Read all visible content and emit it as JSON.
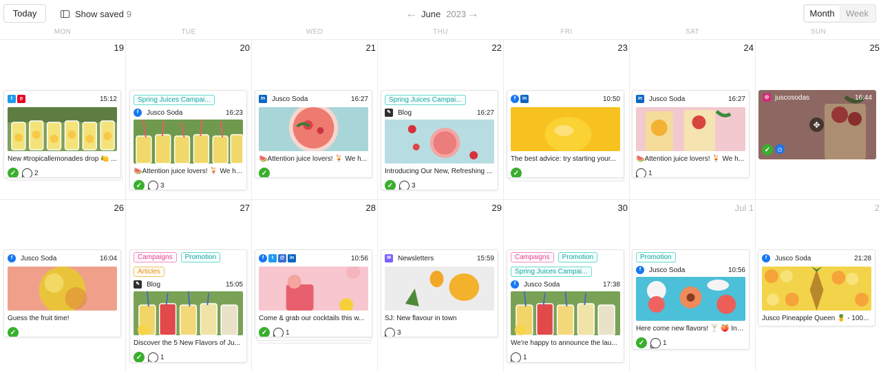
{
  "toolbar": {
    "today_label": "Today",
    "show_saved_label": "Show saved",
    "show_saved_count": "9",
    "month_label": "June",
    "year_label": "2023",
    "view_month": "Month",
    "view_week": "Week"
  },
  "day_names": [
    "MON",
    "TUE",
    "WED",
    "THU",
    "FRI",
    "SAT",
    "SUN"
  ],
  "weeks": [
    {
      "days": [
        "19",
        "20",
        "21",
        "22",
        "23",
        "24",
        "25"
      ]
    },
    {
      "days": [
        "26",
        "27",
        "28",
        "29",
        "30",
        "Jul 1",
        "2"
      ]
    }
  ],
  "posts": {
    "mon19": {
      "time": "15:12",
      "caption": "New #tropicallemonades drop 🍋 ...",
      "comments": "2",
      "networks": [
        "twitter-icon",
        "pinterest-icon"
      ]
    },
    "tue20": {
      "tag1": "Spring Juices Campai...",
      "account": "Jusco Soda",
      "time": "16:23",
      "caption": "🍉Attention juice lovers! 🍹 We ha...",
      "comments": "3"
    },
    "wed21": {
      "account": "Jusco Soda",
      "time": "16:27",
      "caption": "🍉Attention juice lovers! 🍹 We h..."
    },
    "thu22": {
      "tag1": "Spring Juices Campai...",
      "account": "Blog",
      "time": "16:27",
      "caption": "Introducing Our New, Refreshing ...",
      "comments": "3"
    },
    "fri23": {
      "time": "10:50",
      "caption": "The best advice: try starting your..."
    },
    "sat24": {
      "account": "Jusco Soda",
      "time": "16:27",
      "caption": "🍉Attention juice lovers! 🍹 We h...",
      "comments": "1"
    },
    "sun25": {
      "account": "juscosodas",
      "time": "16:44"
    },
    "mon26": {
      "account": "Jusco Soda",
      "time": "16:04",
      "caption": "Guess the fruit time!"
    },
    "tue27": {
      "tag1": "Campaigns",
      "tag2": "Promotion",
      "tag3": "Articles",
      "account": "Blog",
      "time": "15:05",
      "caption": "Discover the 5 New Flavors of Ju...",
      "comments": "1"
    },
    "wed28": {
      "time": "10:56",
      "caption": "Come & grab our cocktails this w...",
      "comments": "1"
    },
    "thu29": {
      "account": "Newsletters",
      "time": "15:59",
      "caption": "SJ: New flavour in town",
      "comments": "3"
    },
    "fri30": {
      "tag1": "Campaigns",
      "tag2": "Promotion",
      "tag3": "Spring Juices Campai...",
      "account": "Jusco Soda",
      "time": "17:38",
      "caption": "We're happy to announce the lau...",
      "comments": "1"
    },
    "satjul1": {
      "tag1": "Promotion",
      "account": "Jusco Soda",
      "time": "10:56",
      "caption": "Here come new flavors! 🍸 🍑 Intr...",
      "comments": "1"
    },
    "sun2": {
      "account": "Jusco Soda",
      "time": "21:28",
      "caption": "Jusco Pineapple Queen 🍍 - 100..."
    }
  },
  "colors": {
    "approved_green": "#3aaf2e",
    "tag_teal": "#13a5a2",
    "tag_pink": "#e2478f",
    "tag_orange": "#e38f12"
  }
}
